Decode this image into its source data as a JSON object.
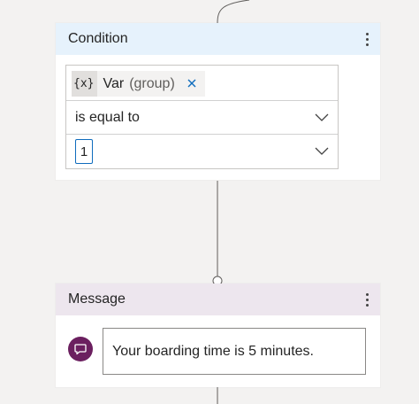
{
  "condition_node": {
    "title": "Condition",
    "variable": {
      "icon_text": "{x}",
      "name": "Var",
      "group": "(group)"
    },
    "operator": "is equal to",
    "value": "1"
  },
  "message_node": {
    "title": "Message",
    "text": "Your boarding time is 5 minutes."
  },
  "icons": {
    "more": "more-vertical-icon",
    "close": "close-icon",
    "chevron": "chevron-down-icon",
    "message": "chat-bubble-icon"
  },
  "colors": {
    "condition_header_bg": "#e6f2fc",
    "message_header_bg": "#ede6ee",
    "message_avatar": "#6b1f5f",
    "value_border": "#0f6cbd",
    "close_icon": "#0f6cbd"
  }
}
